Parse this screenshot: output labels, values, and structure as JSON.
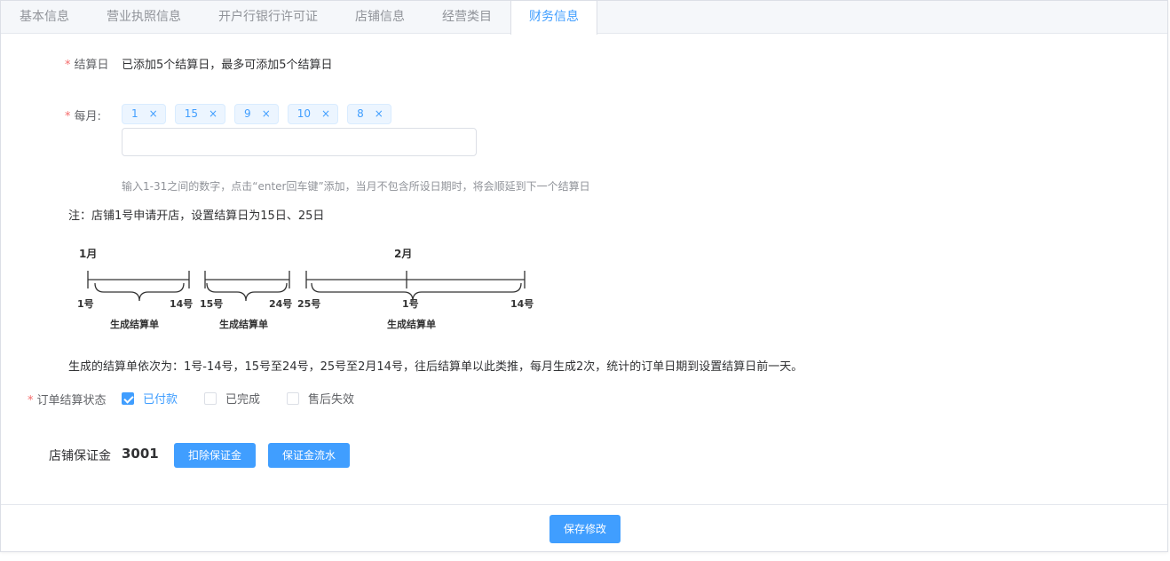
{
  "tabs": [
    "基本信息",
    "营业执照信息",
    "开户行银行许可证",
    "店铺信息",
    "经营类目",
    "财务信息"
  ],
  "settlement": {
    "label": "结算日",
    "summary": "已添加5个结算日，最多可添加5个结算日"
  },
  "monthly": {
    "label": "每月:",
    "tags": [
      "1",
      "15",
      "9",
      "10",
      "8"
    ],
    "tag_close": "×",
    "input_value": "",
    "hint": "输入1-31之间的数字，点击“enter回车键”添加，当月不包含所设日期时，将会顺延到下一个结算日"
  },
  "note": "注：店铺1号申请开店，设置结算日为15日、25日",
  "diagram": {
    "month1": "1月",
    "month2": "2月",
    "ticks": [
      "1号",
      "14号",
      "15号",
      "24号",
      "25号",
      "1号",
      "14号"
    ],
    "brace_labels": [
      "生成结算单",
      "生成结算单",
      "生成结算单"
    ]
  },
  "sequence_text": "生成的结算单依次为：1号-14号，15号至24号，25号至2月14号，往后结算单以此类推，每月生成2次，统计的订单日期到设置结算日前一天。",
  "order_status": {
    "label": "订单结算状态",
    "options": [
      "已付款",
      "已完成",
      "售后失效"
    ],
    "checked": [
      true,
      false,
      false
    ]
  },
  "deposit": {
    "label": "店铺保证金",
    "value": "3001",
    "deduct_button": "扣除保证金",
    "flow_button": "保证金流水"
  },
  "footer": {
    "save_button": "保存修改"
  },
  "colors": {
    "accent": "#409eff",
    "required": "#f56c6c"
  }
}
